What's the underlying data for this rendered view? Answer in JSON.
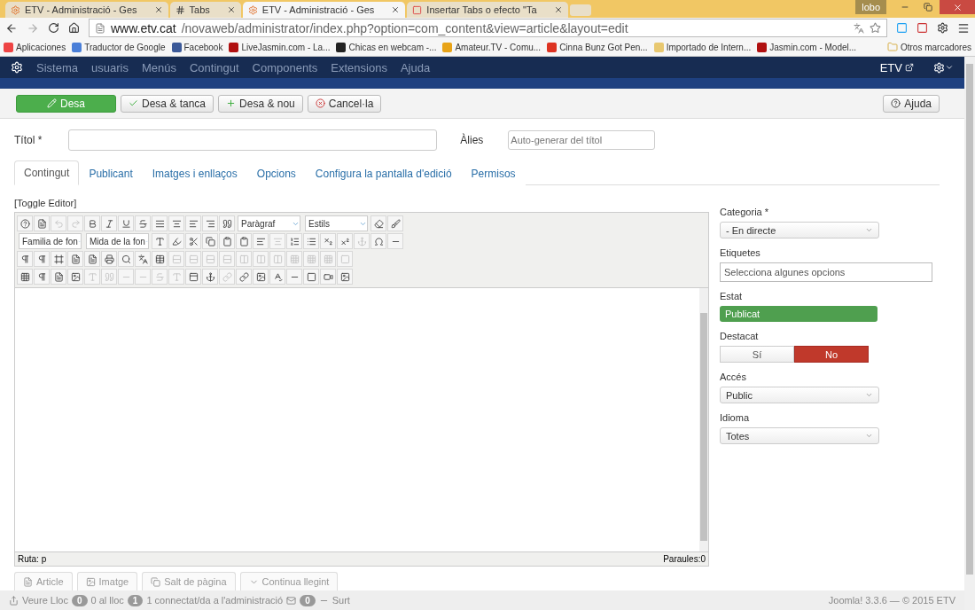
{
  "browser": {
    "tabs": [
      {
        "label": "ETV - Administració - Ges",
        "selected": false
      },
      {
        "label": "Tabs",
        "selected": false
      },
      {
        "label": "ETV - Administració - Ges",
        "selected": true
      },
      {
        "label": "Insertar Tabs o efecto \"Ta",
        "selected": false
      }
    ],
    "user": "lobo",
    "url_host": "www.etv.cat",
    "url_path": "/novaweb/administrator/index.php?option=com_content&view=article&layout=edit",
    "bookmarks": [
      "Aplicaciones",
      "Traductor de Google",
      "Facebook",
      "LiveJasmin.com - La...",
      "Chicas en webcam -...",
      "Amateur.TV - Comu...",
      "Cinna Bunz Got Pen...",
      "Importado de Intern...",
      "Jasmin.com - Model..."
    ],
    "other_bookmarks": "Otros marcadores"
  },
  "navbar": {
    "menu": [
      "Sistema",
      "usuaris",
      "Menús",
      "Contingut",
      "Components",
      "Extensions",
      "Ajuda"
    ],
    "site": "ETV"
  },
  "toolbar": {
    "buttons": [
      {
        "label": "Desa",
        "kind": "primary"
      },
      {
        "label": "Desa & tanca",
        "kind": "default"
      },
      {
        "label": "Desa & nou",
        "kind": "default"
      },
      {
        "label": "Cancel·la",
        "kind": "default"
      }
    ],
    "help": "Ajuda"
  },
  "form": {
    "title_label": "Títol *",
    "alias_label": "Àlies",
    "alias_placeholder": "Auto-generar del títol"
  },
  "tabs": [
    {
      "label": "Contingut",
      "selected": true
    },
    {
      "label": "Publicant",
      "selected": false
    },
    {
      "label": "Imatges i enllaços",
      "selected": false
    },
    {
      "label": "Opcions",
      "selected": false
    },
    {
      "label": "Configura la pantalla d'edició",
      "selected": false
    },
    {
      "label": "Permisos",
      "selected": false
    }
  ],
  "editor": {
    "toggle": "[Toggle Editor]",
    "toolbar": [
      {
        "items": [
          {
            "kind": "button",
            "disabled": false
          },
          {
            "kind": "button",
            "disabled": false
          },
          {
            "kind": "button",
            "disabled": true
          },
          {
            "kind": "button",
            "disabled": true
          },
          {
            "kind": "button",
            "disabled": false
          },
          {
            "kind": "button",
            "disabled": false
          },
          {
            "kind": "button",
            "disabled": false
          },
          {
            "kind": "button",
            "disabled": false
          },
          {
            "kind": "button",
            "disabled": false
          },
          {
            "kind": "button",
            "disabled": false
          },
          {
            "kind": "button",
            "disabled": false
          },
          {
            "kind": "button",
            "disabled": false
          },
          {
            "kind": "button",
            "disabled": false
          },
          {
            "kind": "select",
            "value": "Paràgraf"
          },
          {
            "kind": "select",
            "value": "Estils"
          },
          {
            "kind": "button",
            "disabled": false
          },
          {
            "kind": "button",
            "disabled": false
          }
        ]
      },
      {
        "items": [
          {
            "kind": "select",
            "value": "Familia de fon"
          },
          {
            "kind": "select",
            "value": "Mida de la fon"
          },
          {
            "kind": "button",
            "disabled": false
          },
          {
            "kind": "button",
            "disabled": false
          },
          {
            "kind": "button",
            "disabled": false
          },
          {
            "kind": "button",
            "disabled": false
          },
          {
            "kind": "button",
            "disabled": false
          },
          {
            "kind": "button",
            "disabled": false
          },
          {
            "kind": "button",
            "disabled": false
          },
          {
            "kind": "button",
            "disabled": true
          },
          {
            "kind": "button",
            "disabled": false
          },
          {
            "kind": "button",
            "disabled": false
          },
          {
            "kind": "button",
            "disabled": false
          },
          {
            "kind": "button",
            "disabled": false
          },
          {
            "kind": "button",
            "disabled": true
          },
          {
            "kind": "button",
            "disabled": false
          },
          {
            "kind": "button",
            "disabled": false
          }
        ]
      },
      {
        "items": [
          {
            "kind": "button",
            "disabled": false
          },
          {
            "kind": "button",
            "disabled": false
          },
          {
            "kind": "button",
            "disabled": false
          },
          {
            "kind": "button",
            "disabled": false
          },
          {
            "kind": "button",
            "disabled": false
          },
          {
            "kind": "button",
            "disabled": false
          },
          {
            "kind": "button",
            "disabled": false
          },
          {
            "kind": "button",
            "disabled": false
          },
          {
            "kind": "button",
            "disabled": false
          },
          {
            "kind": "button",
            "disabled": true
          },
          {
            "kind": "button",
            "disabled": true
          },
          {
            "kind": "button",
            "disabled": true
          },
          {
            "kind": "button",
            "disabled": true
          },
          {
            "kind": "button",
            "disabled": true
          },
          {
            "kind": "button",
            "disabled": true
          },
          {
            "kind": "button",
            "disabled": true
          },
          {
            "kind": "button",
            "disabled": true
          },
          {
            "kind": "button",
            "disabled": true
          },
          {
            "kind": "button",
            "disabled": true
          },
          {
            "kind": "button",
            "disabled": true
          }
        ]
      },
      {
        "items": [
          {
            "kind": "button",
            "disabled": false
          },
          {
            "kind": "button",
            "disabled": false
          },
          {
            "kind": "button",
            "disabled": false
          },
          {
            "kind": "button",
            "disabled": false
          },
          {
            "kind": "button",
            "disabled": true
          },
          {
            "kind": "button",
            "disabled": true
          },
          {
            "kind": "button",
            "disabled": true
          },
          {
            "kind": "button",
            "disabled": true
          },
          {
            "kind": "button",
            "disabled": true
          },
          {
            "kind": "button",
            "disabled": true
          },
          {
            "kind": "button",
            "disabled": false
          },
          {
            "kind": "button",
            "disabled": false
          },
          {
            "kind": "button",
            "disabled": true
          },
          {
            "kind": "button",
            "disabled": false
          },
          {
            "kind": "button",
            "disabled": false
          },
          {
            "kind": "button",
            "disabled": false
          },
          {
            "kind": "button",
            "disabled": false
          },
          {
            "kind": "button",
            "disabled": false
          },
          {
            "kind": "button",
            "disabled": false
          },
          {
            "kind": "button",
            "disabled": false
          }
        ]
      }
    ],
    "path_label": "Ruta:",
    "path_value": "p",
    "words": "Paraules:0",
    "buttons": [
      "Article",
      "Imatge",
      "Salt de pàgina",
      "Continua llegint"
    ]
  },
  "sidebar": [
    {
      "label": "Categoria *",
      "kind": "select",
      "value": "- En directe"
    },
    {
      "label": "Etiquetes",
      "kind": "input",
      "placeholder": "Selecciona algunes opcions"
    },
    {
      "label": "Estat",
      "kind": "status",
      "value": "Publicat"
    },
    {
      "label": "Destacat",
      "kind": "toggle",
      "options": [
        {
          "label": "Sí",
          "selected": false
        },
        {
          "label": "No",
          "selected": true
        }
      ]
    },
    {
      "label": "Accés",
      "kind": "select",
      "value": "Public"
    },
    {
      "label": "Idioma",
      "kind": "select",
      "value": "Totes"
    }
  ],
  "status_bar": {
    "view_site": "Veure Lloc",
    "visitors_count": "0",
    "visitors": "0 al lloc",
    "admins_count": "1",
    "admins": "1 connectat/da a l'administració",
    "messages_count": "0",
    "logout": "Surt",
    "version": "Joomla! 3.3.6 — © 2015 ETV"
  }
}
